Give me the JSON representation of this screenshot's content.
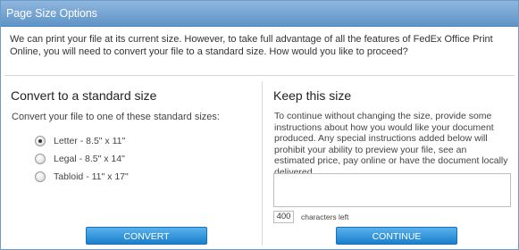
{
  "dialog": {
    "title": "Page Size Options",
    "intro": "We can print your file at its current size.  However, to take full advantage of all the features of FedEx Office Print Online, you will need to convert your file to a standard size.  How would you like to proceed?"
  },
  "convert": {
    "heading": "Convert to a standard size",
    "subtext": "Convert your file to one of these standard sizes:",
    "options": [
      {
        "label": "Letter - 8.5\" x 11\"",
        "selected": true
      },
      {
        "label": "Legal - 8.5\" x 14\"",
        "selected": false
      },
      {
        "label": "Tabloid - 11\" x 17\"",
        "selected": false
      }
    ],
    "button_label": "CONVERT"
  },
  "keep": {
    "heading": "Keep this size",
    "paragraph": "To continue without changing the size, provide some instructions about how you would like your document produced. Any special instructions added below will prohibit your ability to preview your file, see an estimated price, pay online or have the document locally delivered.",
    "instructions_value": "",
    "characters_left": "400",
    "characters_left_label": "characters left",
    "button_label": "CONTINUE"
  },
  "colors": {
    "title_bar": "#6fa3d4",
    "button": "#2a8ad6"
  }
}
